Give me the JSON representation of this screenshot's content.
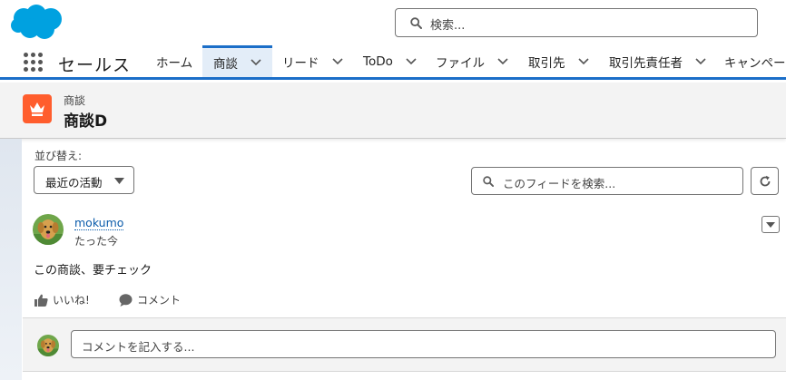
{
  "header": {
    "logo_icon": "salesforce-cloud-logo",
    "search_placeholder": "検索..."
  },
  "nav": {
    "app_name": "セールス",
    "items": [
      {
        "label": "ホーム",
        "has_menu": false,
        "active": false
      },
      {
        "label": "商談",
        "has_menu": true,
        "active": true
      },
      {
        "label": "リード",
        "has_menu": true,
        "active": false
      },
      {
        "label": "ToDo",
        "has_menu": true,
        "active": false
      },
      {
        "label": "ファイル",
        "has_menu": true,
        "active": false
      },
      {
        "label": "取引先",
        "has_menu": true,
        "active": false
      },
      {
        "label": "取引先責任者",
        "has_menu": true,
        "active": false
      },
      {
        "label": "キャンペーン",
        "has_menu": false,
        "active": false
      }
    ]
  },
  "record": {
    "icon": "crown-icon",
    "type_label": "商談",
    "name": "商談D"
  },
  "feed": {
    "sort_label": "並び替え:",
    "sort_value": "最近の活動",
    "search_placeholder": "このフィードを検索...",
    "post": {
      "author": "mokumo",
      "time": "たった今",
      "body": "この商談、要チェック",
      "like_label": "いいね!",
      "comment_label": "コメント"
    },
    "comment_placeholder": "コメントを記入する..."
  },
  "colors": {
    "brand_blue": "#1b6ec8",
    "logo_blue": "#00a1e0",
    "opportunity_orange": "#ff5d2d",
    "link_blue": "#0b5cab"
  }
}
